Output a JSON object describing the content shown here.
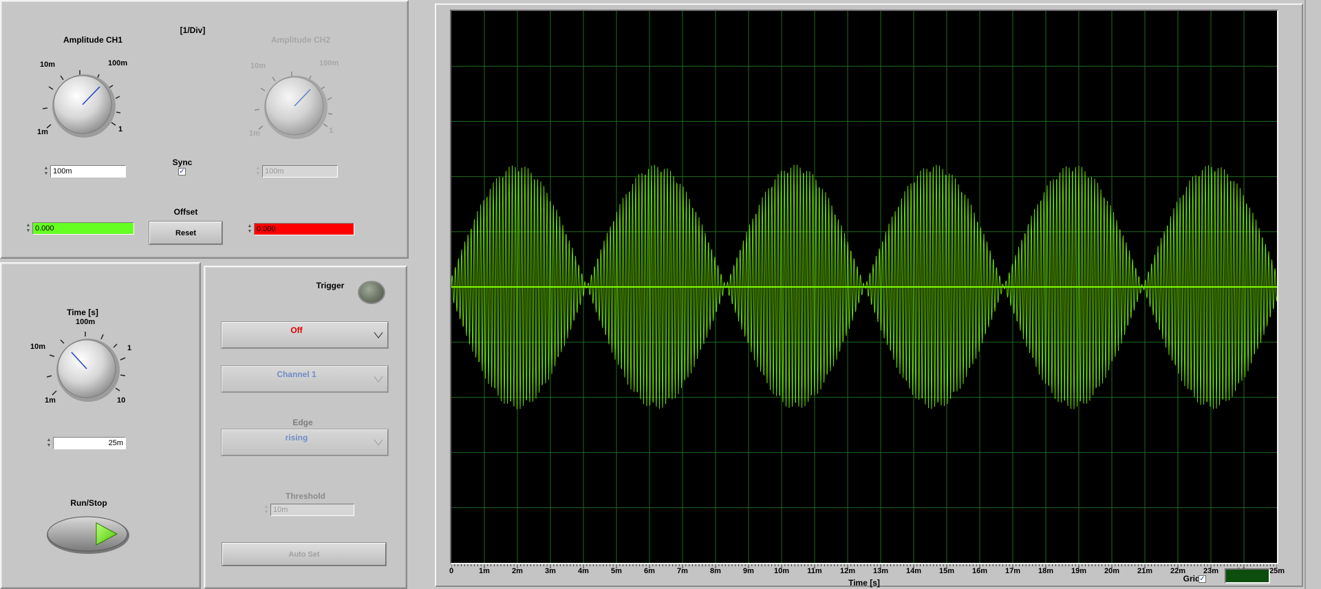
{
  "ch1": {
    "title": "Amplitude CH1",
    "tick_labels": [
      "1m",
      "10m",
      "100m",
      "1"
    ],
    "value": "100m",
    "offset_value": "0.000"
  },
  "ch2": {
    "title": "Amplitude CH2",
    "tick_labels": [
      "1m",
      "10m",
      "100m",
      "1"
    ],
    "value": "100m",
    "offset_value": "0.000"
  },
  "units_label": "[1/Div]",
  "sync": {
    "label": "Sync",
    "checked": "✓"
  },
  "offset": {
    "label": "Offset",
    "reset_label": "Reset"
  },
  "time": {
    "title": "Time [s]",
    "tick_labels": [
      "1m",
      "10m",
      "100m",
      "1",
      "10"
    ],
    "value": "25m"
  },
  "run_stop": {
    "label": "Run/Stop"
  },
  "trigger": {
    "label": "Trigger",
    "mode": "Off",
    "channel": "Channel 1",
    "edge_label": "Edge",
    "edge": "rising",
    "threshold_label": "Threshold",
    "threshold": "10m",
    "auto_set_label": "Auto Set"
  },
  "graph": {
    "x_axis_label": "Time [s]",
    "x_ticks": [
      "0",
      "1m",
      "2m",
      "3m",
      "4m",
      "5m",
      "6m",
      "7m",
      "8m",
      "9m",
      "10m",
      "11m",
      "12m",
      "13m",
      "14m",
      "15m",
      "16m",
      "17m",
      "18m",
      "19m",
      "20m",
      "21m",
      "22m",
      "23m",
      "24m",
      "25m"
    ],
    "grid_label": "Grid",
    "grid_checked": "✓",
    "trace_color": "#7fff00",
    "grid_color": "#1f6b1f",
    "grid_indicator_color": "#0d4d0d"
  },
  "colors": {
    "offset_ch1": "#66ff22",
    "offset_ch2": "#ff0000",
    "trigger_off_text": "#e00000",
    "disabled_blue_text": "#5b7fc8"
  }
}
